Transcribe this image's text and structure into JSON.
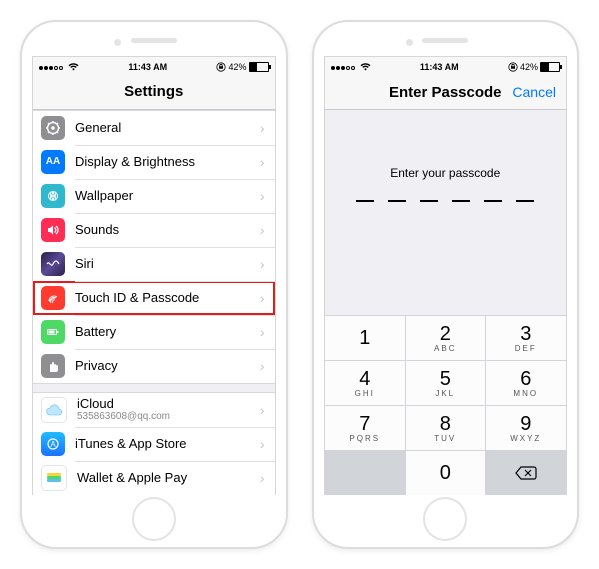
{
  "status": {
    "time": "11:43 AM",
    "battery_pct": "42%"
  },
  "left": {
    "nav_title": "Settings",
    "rows": [
      {
        "label": "General"
      },
      {
        "label": "Display & Brightness"
      },
      {
        "label": "Wallpaper"
      },
      {
        "label": "Sounds"
      },
      {
        "label": "Siri"
      },
      {
        "label": "Touch ID & Passcode"
      },
      {
        "label": "Battery"
      },
      {
        "label": "Privacy"
      }
    ],
    "group2": [
      {
        "label": "iCloud",
        "sub": "535863608@qq.com"
      },
      {
        "label": "iTunes & App Store"
      },
      {
        "label": "Wallet & Apple Pay"
      }
    ]
  },
  "right": {
    "nav_title": "Enter Passcode",
    "cancel": "Cancel",
    "prompt": "Enter your passcode",
    "keys": [
      {
        "d": "1",
        "l": ""
      },
      {
        "d": "2",
        "l": "ABC"
      },
      {
        "d": "3",
        "l": "DEF"
      },
      {
        "d": "4",
        "l": "GHI"
      },
      {
        "d": "5",
        "l": "JKL"
      },
      {
        "d": "6",
        "l": "MNO"
      },
      {
        "d": "7",
        "l": "PQRS"
      },
      {
        "d": "8",
        "l": "TUV"
      },
      {
        "d": "9",
        "l": "WXYZ"
      },
      {
        "d": "0",
        "l": ""
      }
    ]
  }
}
